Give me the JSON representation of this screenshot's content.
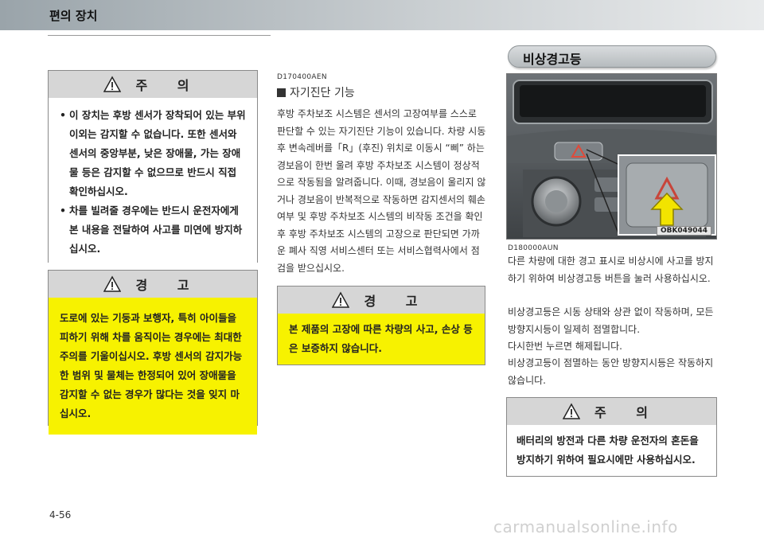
{
  "header": {
    "title": "편의 장치"
  },
  "left_caution": {
    "heading": "주 의",
    "items": [
      "이 장치는 후방 센서가 장착되어 있는 부위 이외는 감지할 수 없습니다. 또한 센서와 센서의 중앙부분, 낮은 장애물, 가는 장애물 등은 감지할 수 없으므로 반드시 직접 확인하십시오.",
      "차를 빌려줄 경우에는 반드시 운전자에게 본 내용을 전달하여 사고를 미연에 방지하십시오."
    ]
  },
  "left_warning": {
    "heading": "경 고",
    "text": "도로에 있는 기둥과 보행자, 특히 아이들을 피하기 위해 차를 움직이는 경우에는 최대한 주의를 기울이십시오. 후방 센서의 감지가능한 범위 및 물체는 한정되어 있어 장애물을 감지할 수 없는 경우가 많다는 것을 잊지 마십시오."
  },
  "middle": {
    "code": "D170400AEN",
    "title": "자기진단 기능",
    "para": "후방 주차보조 시스템은 센서의 고장여부를 스스로 판단할 수 있는 자기진단 기능이 있습니다. 차량 시동후 변속레버를「R」(후진) 위치로 이동시 “삐” 하는 경보음이 한번 울려 후방 주차보조 시스템이 정상적으로 작동됨을 알려줍니다. 이때, 경보음이 울리지 않거나 경보음이 반복적으로 작동하면 감지센서의 훼손여부 및 후방 주차보조 시스템의 비작동 조건을 확인 후 후방 주차보조 시스템의 고장으로 판단되면 가까운 폐사 직영 서비스센터 또는 서비스협력사에서 점검을 받으십시오.",
    "warning": {
      "heading": "경 고",
      "text": "본 제품의 고장에 따른 차량의 사고, 손상 등은 보증하지 않습니다."
    }
  },
  "right": {
    "section_pill": "비상경고등",
    "photo_code": "OBK049044",
    "code": "D180000AUN",
    "para1": "다른 차량에 대한 경고 표시로 비상시에 사고를 방지하기 위하여 비상경고등 버튼을 눌러 사용하십시오.",
    "para2": "비상경고등은 시동 상태와 상관 없이 작동하며, 모든 방향지시등이 일제히 점멸합니다.",
    "para3": "다시한번 누르면 해제됩니다.",
    "para4": "비상경고등이 점멸하는 동안 방향지시등은 작동하지 않습니다.",
    "caution": {
      "heading": "주 의",
      "text": "배터리의 방전과 다른 차량 운전자의 혼돈을 방지하기 위하여 필요시에만 사용하십시오."
    }
  },
  "footer": {
    "page": "4-56",
    "watermark": "carmanualsonline.info"
  },
  "colors": {
    "warning_yellow": "#f7f200",
    "box_header_gray": "#d6d6d6",
    "arrow_yellow": "#f2e400"
  }
}
